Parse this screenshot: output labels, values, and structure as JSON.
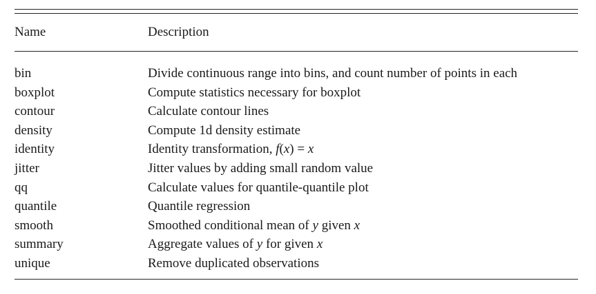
{
  "table": {
    "headers": {
      "name": "Name",
      "description": "Description"
    },
    "rows": [
      {
        "name": "bin",
        "description": "Divide continuous range into bins, and count number of points in each"
      },
      {
        "name": "boxplot",
        "description": "Compute statistics necessary for boxplot"
      },
      {
        "name": "contour",
        "description": "Calculate contour lines"
      },
      {
        "name": "density",
        "description": "Compute 1d density estimate"
      },
      {
        "name": "identity",
        "description": "Identity transformation, f(x) = x"
      },
      {
        "name": "jitter",
        "description": "Jitter values by adding small random value"
      },
      {
        "name": "qq",
        "description": "Calculate values for quantile-quantile plot"
      },
      {
        "name": "quantile",
        "description": "Quantile regression"
      },
      {
        "name": "smooth",
        "description": "Smoothed conditional mean of y given x"
      },
      {
        "name": "summary",
        "description": "Aggregate values of y for given x"
      },
      {
        "name": "unique",
        "description": "Remove duplicated observations"
      }
    ]
  }
}
